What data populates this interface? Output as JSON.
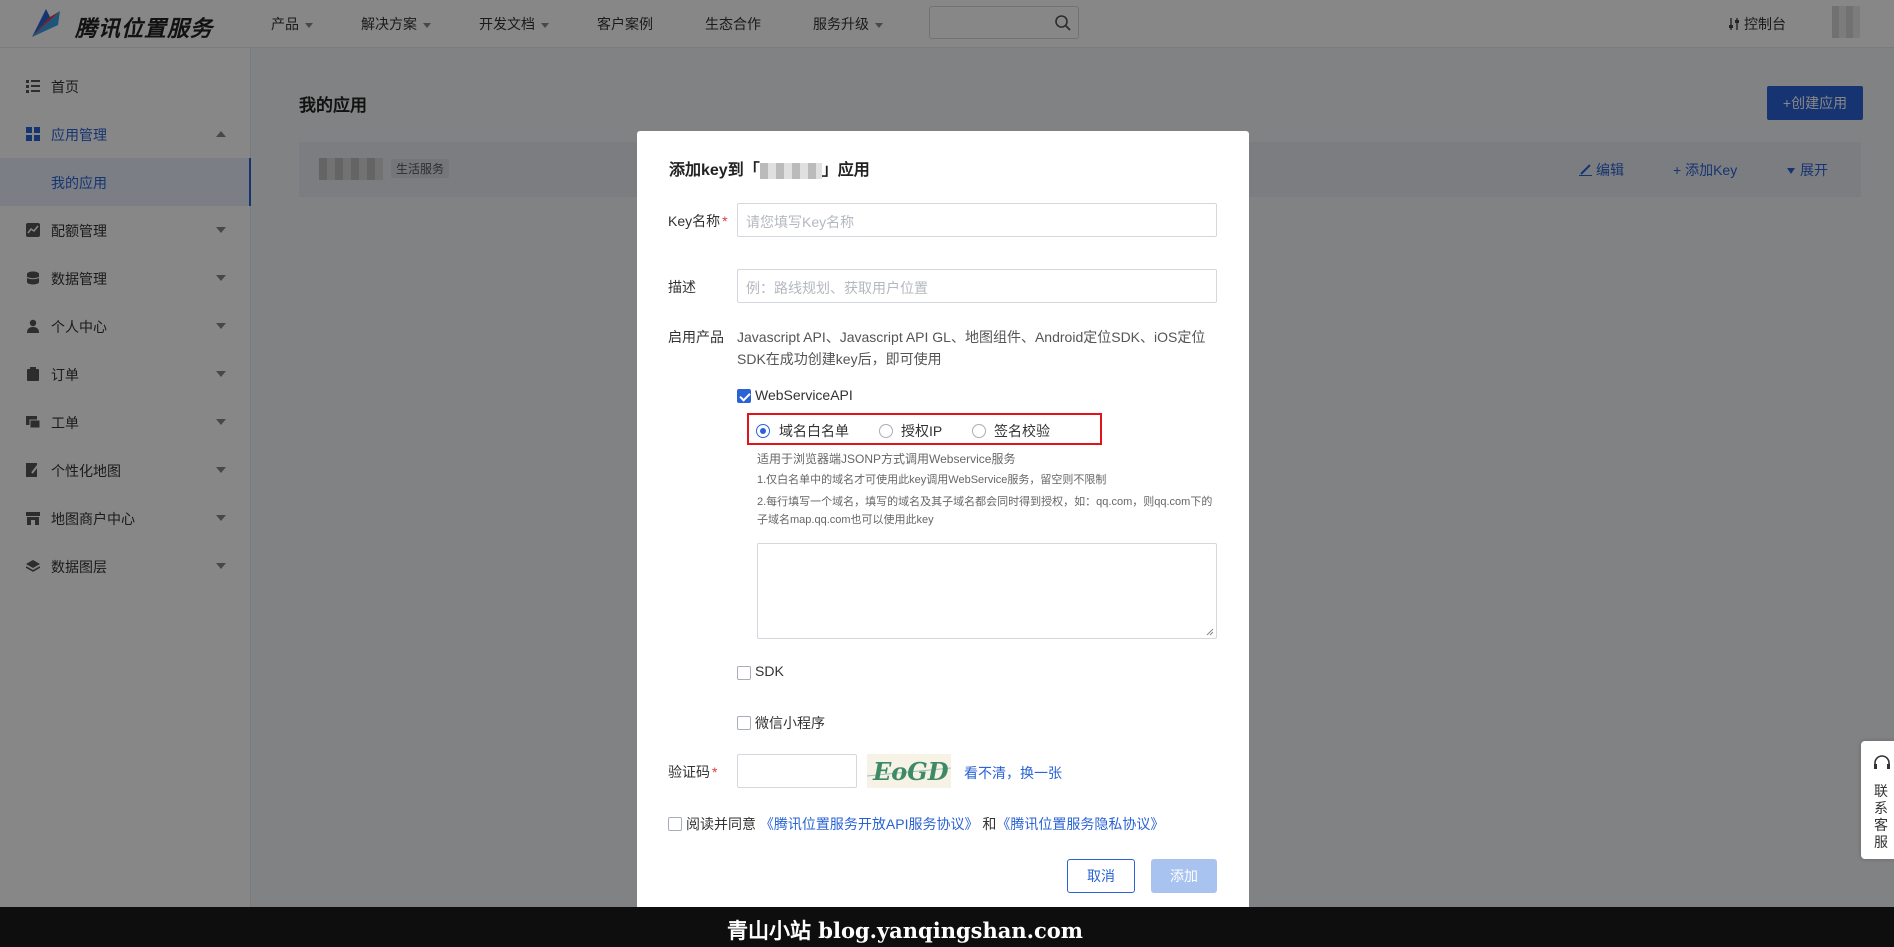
{
  "brand": "腾讯位置服务",
  "nav": {
    "items": [
      "产品",
      "解决方案",
      "开发文档",
      "客户案例",
      "生态合作",
      "服务升级"
    ],
    "console": "控制台"
  },
  "sidebar": {
    "items": [
      {
        "label": "首页",
        "icon": "home-list-icon"
      },
      {
        "label": "应用管理",
        "icon": "grid-icon"
      },
      {
        "label": "配额管理",
        "icon": "chart-icon"
      },
      {
        "label": "数据管理",
        "icon": "database-icon"
      },
      {
        "label": "个人中心",
        "icon": "user-icon"
      },
      {
        "label": "订单",
        "icon": "clipboard-icon"
      },
      {
        "label": "工单",
        "icon": "ticket-icon"
      },
      {
        "label": "个性化地图",
        "icon": "paint-icon"
      },
      {
        "label": "地图商户中心",
        "icon": "store-icon"
      },
      {
        "label": "数据图层",
        "icon": "layers-icon"
      }
    ],
    "sub_active": "我的应用"
  },
  "main": {
    "title": "我的应用",
    "create_button": "+创建应用",
    "app_tag": "生活服务",
    "actions": {
      "edit": "编辑",
      "add_key": "+ 添加Key",
      "expand": "展开"
    }
  },
  "modal": {
    "title_prefix": "添加key到「",
    "title_suffix": "」应用",
    "key_name_label": "Key名称",
    "key_name_placeholder": "请您填写Key名称",
    "desc_label": "描述",
    "desc_placeholder": "例：路线规划、获取用户位置",
    "products_label": "启用产品",
    "products_desc": "Javascript API、Javascript API GL、地图组件、Android定位SDK、iOS定位SDK在成功创建key后，即可使用",
    "webservice_label": "WebServiceAPI",
    "radio_options": [
      "域名白名单",
      "授权IP",
      "签名校验"
    ],
    "hint_title": "适用于浏览器端JSONP方式调用Webservice服务",
    "hint_1": "1.仅白名单中的域名才可使用此key调用WebService服务，留空则不限制",
    "hint_2": "2.每行填写一个域名，填写的域名及其子域名都会同时得到授权，如：qq.com，则qq.com下的子域名map.qq.com也可以使用此key",
    "sdk_label": "SDK",
    "miniprogram_label": "微信小程序",
    "captcha_label": "验证码",
    "captcha_text": "EoGD",
    "captcha_refresh": "看不清，换一张",
    "agree_prefix": "阅读并同意",
    "agree_link1": "《腾讯位置服务开放API服务协议》",
    "agree_and": "和",
    "agree_link2": "《腾讯位置服务隐私协议》",
    "cancel": "取消",
    "add": "添加"
  },
  "contact": "联系客服",
  "watermark": "青山小站 blog.yanqingshan.com",
  "colors": {
    "accent": "#2a63d6",
    "highlight_box": "#e3131c"
  }
}
